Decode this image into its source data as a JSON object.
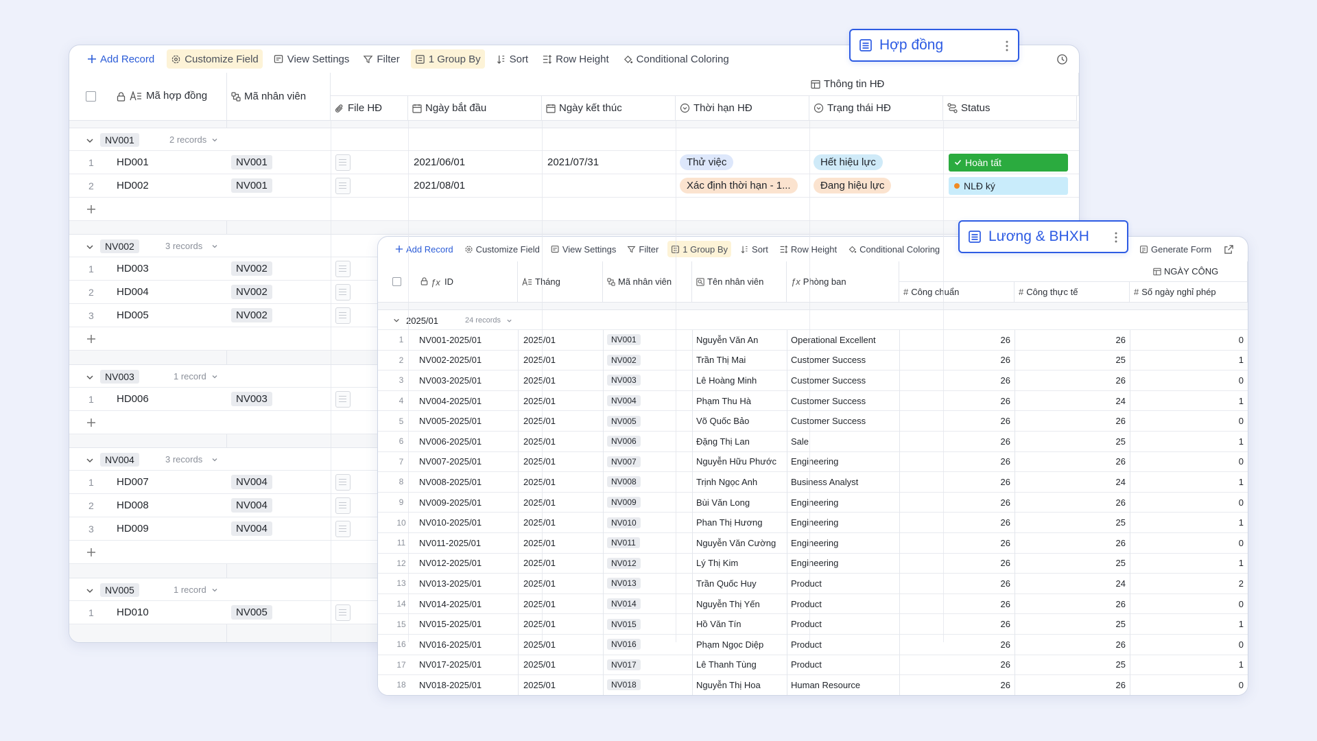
{
  "colors": {
    "accent": "#2d5be3",
    "groupby_bg": "#fdf3d7",
    "done_green": "#2bab3f",
    "signed_blue": "#c9ecfb"
  },
  "w1": {
    "toolbar": {
      "add_record": "Add Record",
      "customize_field": "Customize Field",
      "view_settings": "View Settings",
      "filter": "Filter",
      "group_by": "1 Group By",
      "sort": "Sort",
      "row_height": "Row Height",
      "conditional_coloring": "Conditional Coloring"
    },
    "badge": "Hợp đồng",
    "group_header": "Thông tin HĐ",
    "columns": {
      "ma_hop_dong": "Mã hợp đồng",
      "ma_nhan_vien": "Mã nhân viên",
      "file_hd": "File HĐ",
      "ngay_bat_dau": "Ngày bắt đầu",
      "ngay_ket_thuc": "Ngày kết thúc",
      "thoi_han": "Thời hạn HĐ",
      "trang_thai": "Trạng thái HĐ",
      "status": "Status"
    },
    "groups": [
      {
        "name": "NV001",
        "count": "2 records",
        "rows": [
          {
            "n": "1",
            "ma": "HD001",
            "nv": "NV001",
            "start": "2021/06/01",
            "end": "2021/07/31",
            "thoi_han": "Thử việc",
            "trang_thai": "Hết hiệu lực",
            "status": "Hoàn tất"
          },
          {
            "n": "2",
            "ma": "HD002",
            "nv": "NV001",
            "start": "2021/08/01",
            "end": "",
            "thoi_han": "Xác định thời hạn - 1...",
            "trang_thai": "Đang hiệu lực",
            "status": "NLĐ ký"
          }
        ]
      },
      {
        "name": "NV002",
        "count": "3 records",
        "rows": [
          {
            "n": "1",
            "ma": "HD003",
            "nv": "NV002"
          },
          {
            "n": "2",
            "ma": "HD004",
            "nv": "NV002"
          },
          {
            "n": "3",
            "ma": "HD005",
            "nv": "NV002"
          }
        ]
      },
      {
        "name": "NV003",
        "count": "1 record",
        "rows": [
          {
            "n": "1",
            "ma": "HD006",
            "nv": "NV003"
          }
        ]
      },
      {
        "name": "NV004",
        "count": "3 records",
        "rows": [
          {
            "n": "1",
            "ma": "HD007",
            "nv": "NV004"
          },
          {
            "n": "2",
            "ma": "HD008",
            "nv": "NV004"
          },
          {
            "n": "3",
            "ma": "HD009",
            "nv": "NV004"
          }
        ]
      },
      {
        "name": "NV005",
        "count": "1 record",
        "rows": [
          {
            "n": "1",
            "ma": "HD010",
            "nv": "NV005"
          }
        ]
      }
    ]
  },
  "w2": {
    "toolbar": {
      "add_record": "Add Record",
      "customize_field": "Customize Field",
      "view_settings": "View Settings",
      "filter": "Filter",
      "group_by": "1 Group By",
      "sort": "Sort",
      "row_height": "Row Height",
      "conditional_coloring": "Conditional Coloring",
      "generate_form": "Generate Form"
    },
    "badge": "Lương & BHXH",
    "group_header": "NGÀY CÔNG",
    "columns": {
      "id": "ID",
      "thang": "Tháng",
      "ma_nv": "Mã nhân viên",
      "ten_nv": "Tên nhân viên",
      "phong_ban": "Phòng ban",
      "cong_chuan": "Công chuẩn",
      "cong_thuc_te": "Công thực tế",
      "nghi_phep": "Số ngày nghỉ phép"
    },
    "group": {
      "name": "2025/01",
      "count": "24 records"
    },
    "rows": [
      {
        "n": "1",
        "id": "NV001-2025/01",
        "thang": "2025/01",
        "nv": "NV001",
        "ten": "Nguyễn Văn An",
        "pb": "Operational Excellent",
        "cc": "26",
        "ct": "26",
        "np": "0"
      },
      {
        "n": "2",
        "id": "NV002-2025/01",
        "thang": "2025/01",
        "nv": "NV002",
        "ten": "Trần Thị Mai",
        "pb": "Customer Success",
        "cc": "26",
        "ct": "25",
        "np": "1"
      },
      {
        "n": "3",
        "id": "NV003-2025/01",
        "thang": "2025/01",
        "nv": "NV003",
        "ten": "Lê Hoàng Minh",
        "pb": "Customer Success",
        "cc": "26",
        "ct": "26",
        "np": "0"
      },
      {
        "n": "4",
        "id": "NV004-2025/01",
        "thang": "2025/01",
        "nv": "NV004",
        "ten": "Phạm Thu Hà",
        "pb": "Customer Success",
        "cc": "26",
        "ct": "24",
        "np": "1"
      },
      {
        "n": "5",
        "id": "NV005-2025/01",
        "thang": "2025/01",
        "nv": "NV005",
        "ten": "Võ Quốc Bảo",
        "pb": "Customer Success",
        "cc": "26",
        "ct": "26",
        "np": "0"
      },
      {
        "n": "6",
        "id": "NV006-2025/01",
        "thang": "2025/01",
        "nv": "NV006",
        "ten": "Đặng Thị Lan",
        "pb": "Sale",
        "cc": "26",
        "ct": "25",
        "np": "1"
      },
      {
        "n": "7",
        "id": "NV007-2025/01",
        "thang": "2025/01",
        "nv": "NV007",
        "ten": "Nguyễn Hữu Phước",
        "pb": "Engineering",
        "cc": "26",
        "ct": "26",
        "np": "0"
      },
      {
        "n": "8",
        "id": "NV008-2025/01",
        "thang": "2025/01",
        "nv": "NV008",
        "ten": "Trịnh Ngọc Anh",
        "pb": "Business Analyst",
        "cc": "26",
        "ct": "24",
        "np": "1"
      },
      {
        "n": "9",
        "id": "NV009-2025/01",
        "thang": "2025/01",
        "nv": "NV009",
        "ten": "Bùi Văn Long",
        "pb": "Engineering",
        "cc": "26",
        "ct": "26",
        "np": "0"
      },
      {
        "n": "10",
        "id": "NV010-2025/01",
        "thang": "2025/01",
        "nv": "NV010",
        "ten": "Phan Thị Hương",
        "pb": "Engineering",
        "cc": "26",
        "ct": "25",
        "np": "1"
      },
      {
        "n": "11",
        "id": "NV011-2025/01",
        "thang": "2025/01",
        "nv": "NV011",
        "ten": "Nguyễn Văn Cường",
        "pb": "Engineering",
        "cc": "26",
        "ct": "26",
        "np": "0"
      },
      {
        "n": "12",
        "id": "NV012-2025/01",
        "thang": "2025/01",
        "nv": "NV012",
        "ten": "Lý Thị Kim",
        "pb": "Engineering",
        "cc": "26",
        "ct": "25",
        "np": "1"
      },
      {
        "n": "13",
        "id": "NV013-2025/01",
        "thang": "2025/01",
        "nv": "NV013",
        "ten": "Trần Quốc Huy",
        "pb": "Product",
        "cc": "26",
        "ct": "24",
        "np": "2"
      },
      {
        "n": "14",
        "id": "NV014-2025/01",
        "thang": "2025/01",
        "nv": "NV014",
        "ten": "Nguyễn Thị Yến",
        "pb": "Product",
        "cc": "26",
        "ct": "26",
        "np": "0"
      },
      {
        "n": "15",
        "id": "NV015-2025/01",
        "thang": "2025/01",
        "nv": "NV015",
        "ten": "Hồ Văn Tín",
        "pb": "Product",
        "cc": "26",
        "ct": "25",
        "np": "1"
      },
      {
        "n": "16",
        "id": "NV016-2025/01",
        "thang": "2025/01",
        "nv": "NV016",
        "ten": "Phạm Ngọc Diệp",
        "pb": "Product",
        "cc": "26",
        "ct": "26",
        "np": "0"
      },
      {
        "n": "17",
        "id": "NV017-2025/01",
        "thang": "2025/01",
        "nv": "NV017",
        "ten": "Lê Thanh Tùng",
        "pb": "Product",
        "cc": "26",
        "ct": "25",
        "np": "1"
      },
      {
        "n": "18",
        "id": "NV018-2025/01",
        "thang": "2025/01",
        "nv": "NV018",
        "ten": "Nguyễn Thị Hoa",
        "pb": "Human Resource",
        "cc": "26",
        "ct": "26",
        "np": "0"
      }
    ]
  }
}
